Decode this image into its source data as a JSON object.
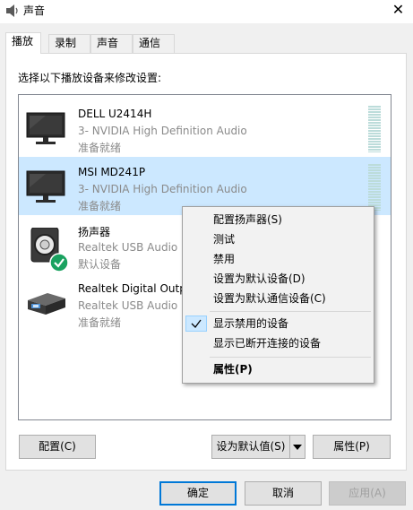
{
  "window": {
    "title": "声音",
    "close_glyph": "✕"
  },
  "tabs": [
    {
      "label": "播放",
      "active": true
    },
    {
      "label": "录制",
      "active": false
    },
    {
      "label": "声音",
      "active": false
    },
    {
      "label": "通信",
      "active": false
    }
  ],
  "instruction": "选择以下播放设备来修改设置:",
  "devices": [
    {
      "name": "DELL U2414H",
      "sub": "3- NVIDIA High Definition Audio",
      "status": "准备就绪",
      "icon": "monitor-icon",
      "selected": false
    },
    {
      "name": "MSI MD241P",
      "sub": "3- NVIDIA High Definition Audio",
      "status": "准备就绪",
      "icon": "monitor-icon",
      "selected": true
    },
    {
      "name": "扬声器",
      "sub": "Realtek USB Audio",
      "status": "默认设备",
      "icon": "speaker-icon",
      "selected": false
    },
    {
      "name": "Realtek Digital Output",
      "sub": "Realtek USB Audio",
      "status": "准备就绪",
      "icon": "digital-output-icon",
      "selected": false
    }
  ],
  "context_menu": {
    "items": [
      {
        "label": "配置扬声器(S)"
      },
      {
        "label": "测试"
      },
      {
        "label": "禁用"
      },
      {
        "label": "设置为默认设备(D)"
      },
      {
        "label": "设置为默认通信设备(C)"
      },
      {
        "label": "显示禁用的设备",
        "checked": true
      },
      {
        "label": "显示已断开连接的设备"
      },
      {
        "label": "属性(P)",
        "bold": true
      }
    ]
  },
  "page_buttons": {
    "configure": "配置(C)",
    "set_default": "设为默认值(S)",
    "properties": "属性(P)"
  },
  "dialog_buttons": {
    "ok": "确定",
    "cancel": "取消",
    "apply": "应用(A)"
  },
  "colors": {
    "selection": "#cce8ff",
    "accent": "#0078d7",
    "default_check": "#1aa260"
  }
}
